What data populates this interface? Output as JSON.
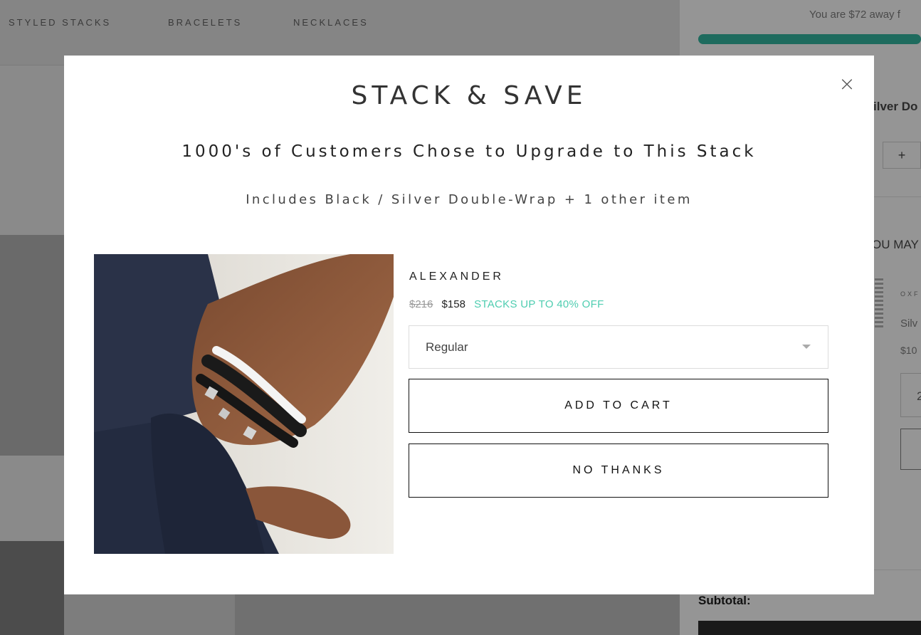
{
  "background": {
    "nav": [
      "STYLED STACKS",
      "BRACELETS",
      "NECKLACES"
    ],
    "drawer": {
      "shipping_message": "You are $72 away f",
      "item_name": "ilver Do",
      "qty_plus": "+",
      "you_may": "OU MAY",
      "rec_brand": "OXF",
      "rec_name": "Silv",
      "rec_price": "$10",
      "rec_qty": "2",
      "subtotal_label": "Subtotal:"
    }
  },
  "modal": {
    "close": "×",
    "title": "STACK & SAVE",
    "subtitle": "1000's of Customers Chose to Upgrade to This Stack",
    "includes": "Includes Black / Silver Double-Wrap + 1 other item",
    "product": {
      "name": "ALEXANDER",
      "price_old": "$216",
      "price_new": "$158",
      "promo": "STACKS UP TO 40% OFF",
      "variant_selected": "Regular"
    },
    "add_to_cart": "ADD TO CART",
    "no_thanks": "NO THANKS"
  },
  "colors": {
    "promo": "#4ecdb0",
    "progress_bar": "#1e6b5e",
    "overlay": "#3a3a3a"
  }
}
